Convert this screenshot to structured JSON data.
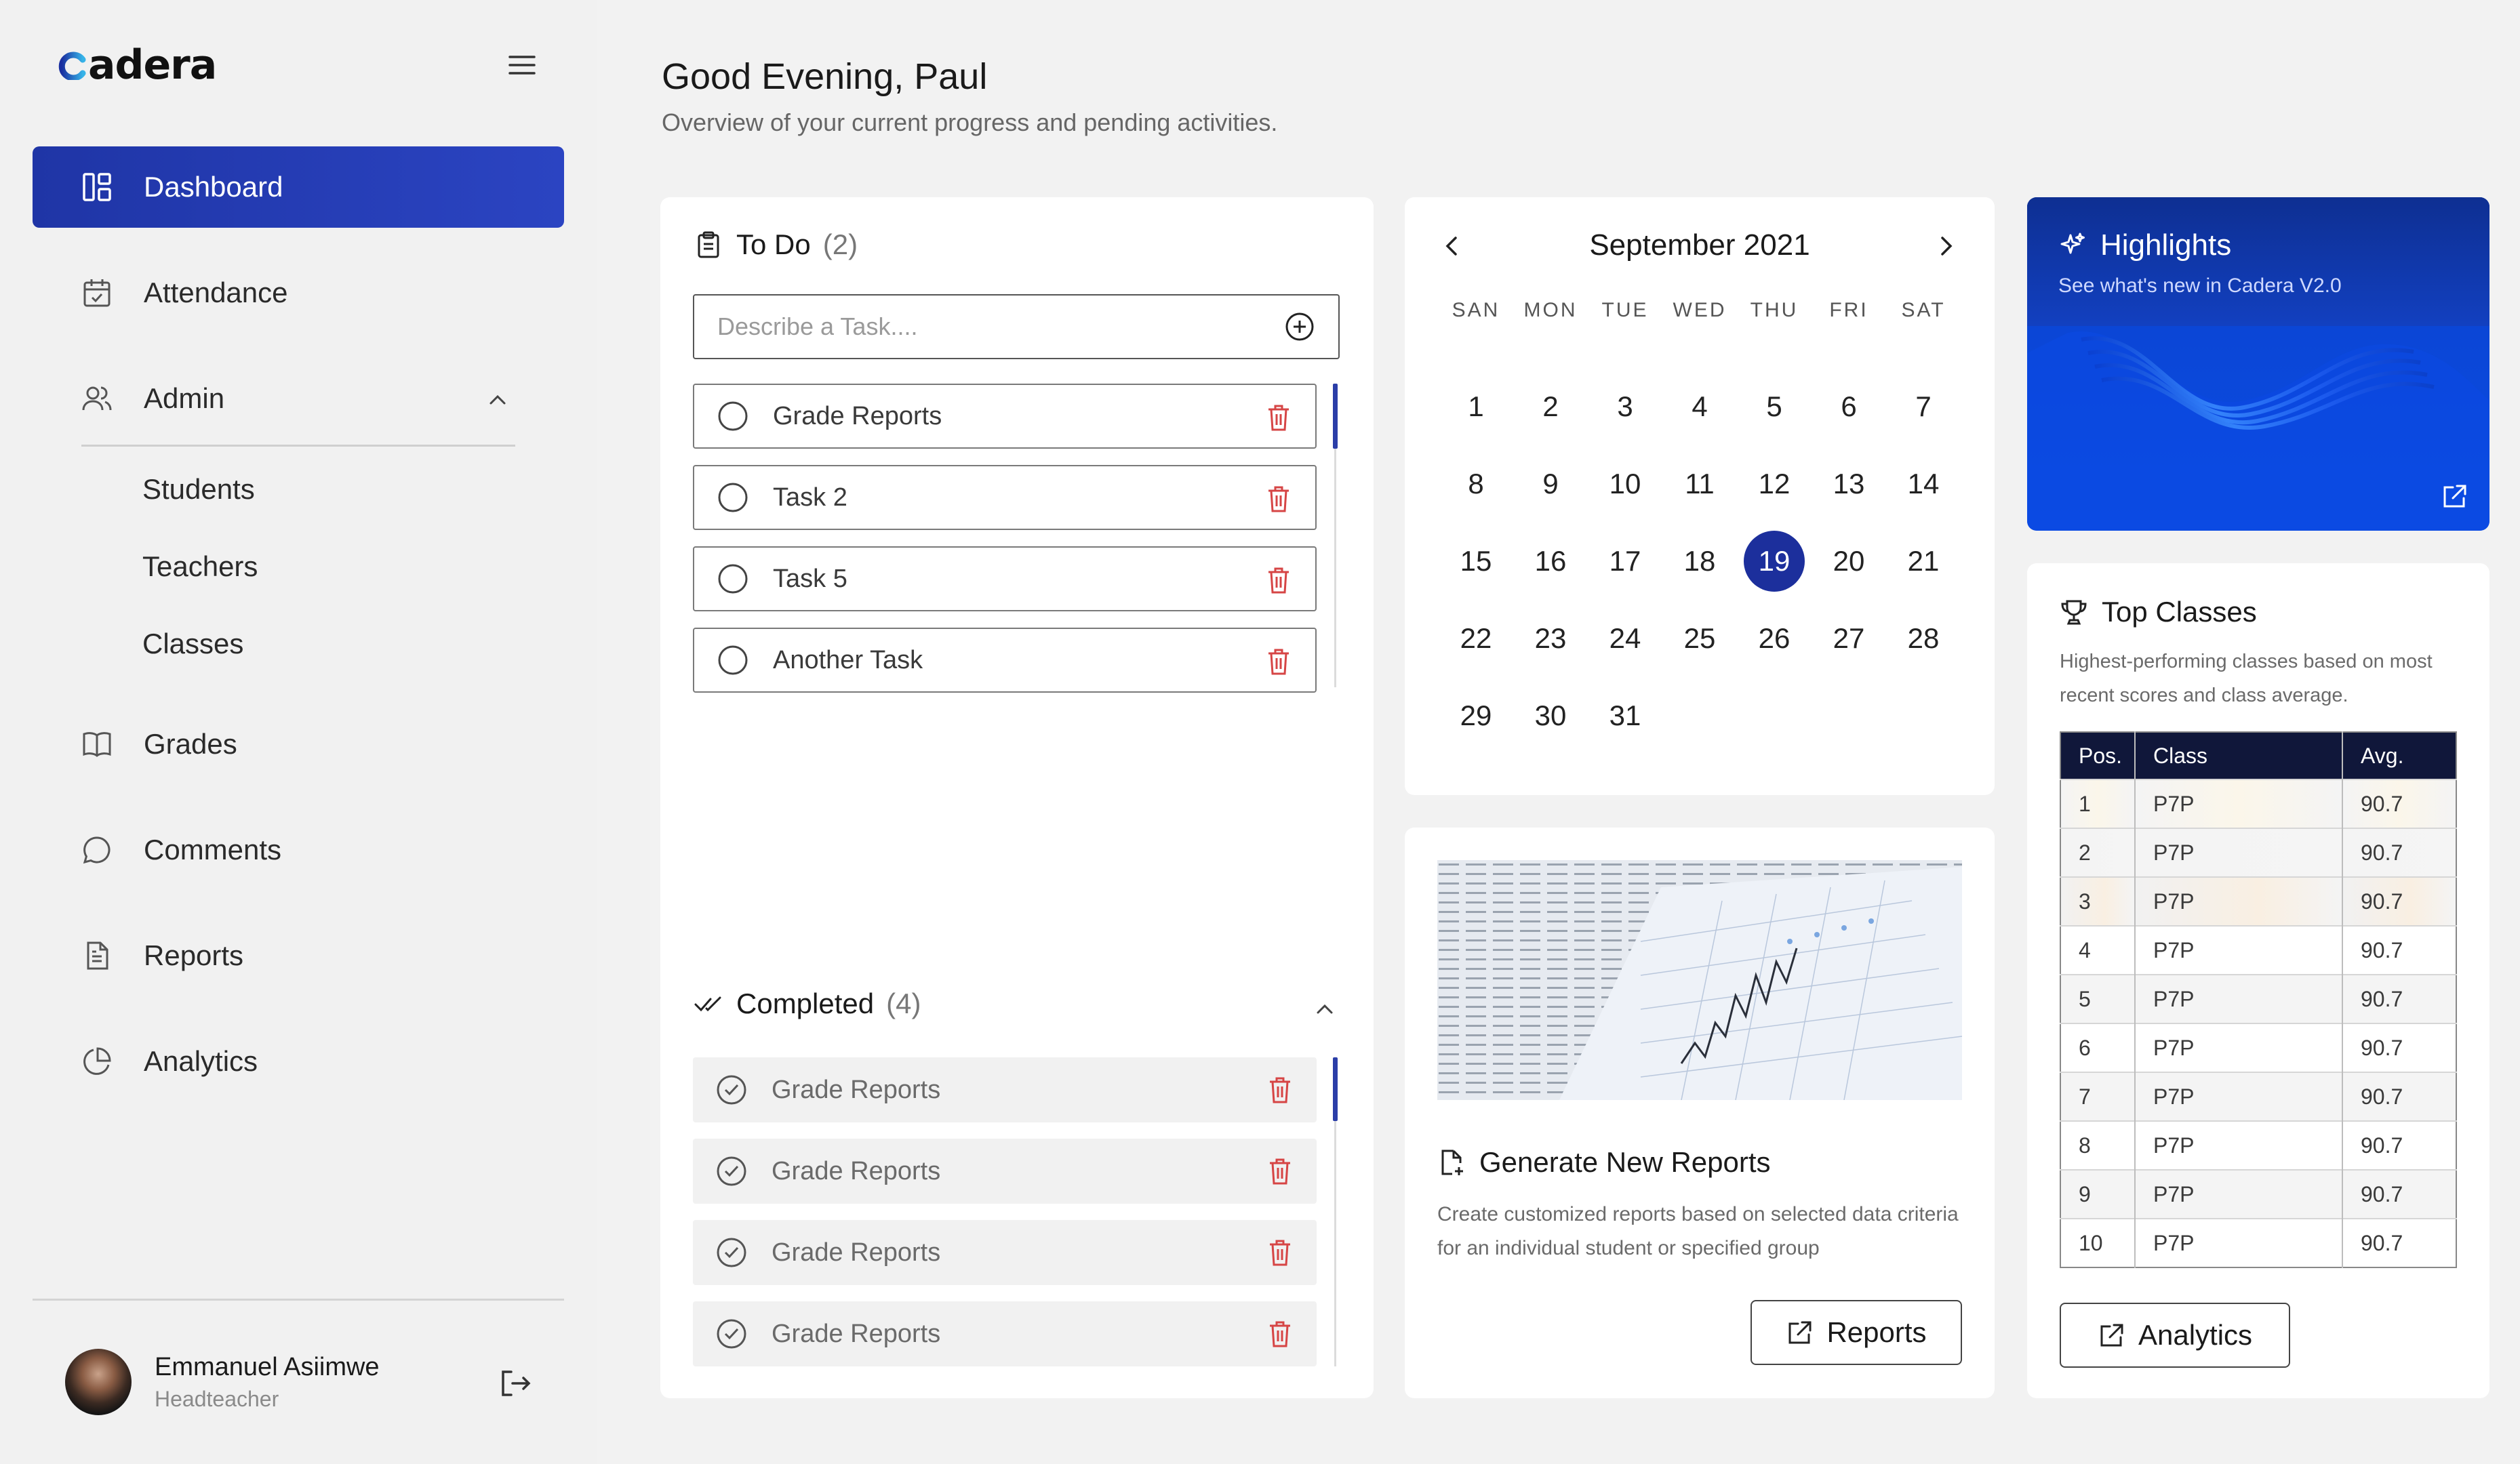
{
  "brand": {
    "name": "adera"
  },
  "sidebar": {
    "items": [
      {
        "label": "Dashboard"
      },
      {
        "label": "Attendance"
      },
      {
        "label": "Admin"
      },
      {
        "label": "Grades"
      },
      {
        "label": "Comments"
      },
      {
        "label": "Reports"
      },
      {
        "label": "Analytics"
      }
    ],
    "admin_sub": [
      "Students",
      "Teachers",
      "Classes"
    ]
  },
  "user": {
    "name": "Emmanuel Asiimwe",
    "role": "Headteacher"
  },
  "header": {
    "greeting": "Good Evening, Paul",
    "subtitle": "Overview of your current progress and pending activities."
  },
  "todo": {
    "title": "To Do",
    "count": "(2)",
    "input_placeholder": "Describe a Task....",
    "tasks": [
      "Grade Reports",
      "Task 2",
      "Task 5",
      "Another Task"
    ],
    "completed_title": "Completed",
    "completed_count": "(4)",
    "completed": [
      "Grade Reports",
      "Grade Reports",
      "Grade Reports",
      "Grade Reports"
    ]
  },
  "calendar": {
    "month": "September 2021",
    "weekdays": [
      "SAN",
      "MON",
      "TUE",
      "WED",
      "THU",
      "FRI",
      "SAT"
    ],
    "days": [
      "1",
      "2",
      "3",
      "4",
      "5",
      "6",
      "7",
      "8",
      "9",
      "10",
      "11",
      "12",
      "13",
      "14",
      "15",
      "16",
      "17",
      "18",
      "19",
      "20",
      "21",
      "22",
      "23",
      "24",
      "25",
      "26",
      "27",
      "28",
      "29",
      "30",
      "31"
    ],
    "selected": "19"
  },
  "reports": {
    "title": "Generate New Reports",
    "description": "Create customized reports based on selected data criteria for an individual student or specified group",
    "button": "Reports"
  },
  "highlights": {
    "title": "Highlights",
    "subtitle": "See what's new in Cadera V2.0"
  },
  "top_classes": {
    "title": "Top Classes",
    "description": "Highest-performing classes based on most recent scores and class average.",
    "headers": [
      "Pos.",
      "Class",
      "Avg."
    ],
    "rows": [
      [
        "1",
        "P7P",
        "90.7"
      ],
      [
        "2",
        "P7P",
        "90.7"
      ],
      [
        "3",
        "P7P",
        "90.7"
      ],
      [
        "4",
        "P7P",
        "90.7"
      ],
      [
        "5",
        "P7P",
        "90.7"
      ],
      [
        "6",
        "P7P",
        "90.7"
      ],
      [
        "7",
        "P7P",
        "90.7"
      ],
      [
        "8",
        "P7P",
        "90.7"
      ],
      [
        "9",
        "P7P",
        "90.7"
      ],
      [
        "10",
        "P7P",
        "90.7"
      ]
    ],
    "button": "Analytics"
  },
  "colors": {
    "accent": "#1f35a6",
    "danger": "#d64545",
    "table_header": "#10173a"
  }
}
